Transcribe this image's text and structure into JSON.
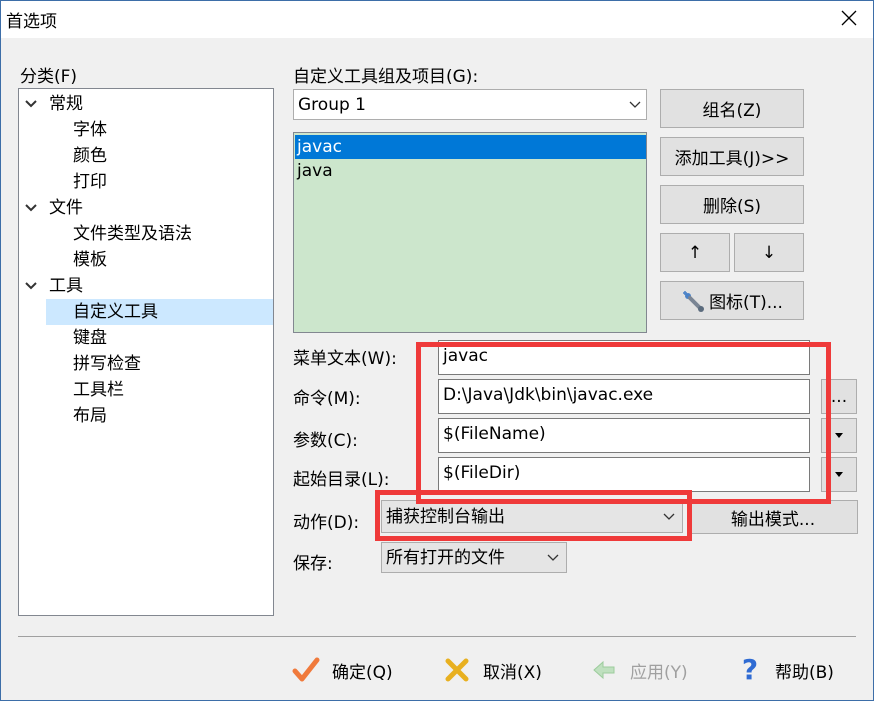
{
  "window": {
    "title": "首选项"
  },
  "left": {
    "label": "分类(F)",
    "tree": [
      {
        "label": "常规",
        "expanded": true,
        "level": 0
      },
      {
        "label": "字体",
        "level": 1
      },
      {
        "label": "颜色",
        "level": 1
      },
      {
        "label": "打印",
        "level": 1
      },
      {
        "label": "文件",
        "expanded": true,
        "level": 0
      },
      {
        "label": "文件类型及语法",
        "level": 1
      },
      {
        "label": "模板",
        "level": 1
      },
      {
        "label": "工具",
        "expanded": true,
        "level": 0
      },
      {
        "label": "自定义工具",
        "level": 1,
        "selected": true
      },
      {
        "label": "键盘",
        "level": 1
      },
      {
        "label": "拼写检查",
        "level": 1
      },
      {
        "label": "工具栏",
        "level": 1
      },
      {
        "label": "布局",
        "level": 1
      }
    ]
  },
  "group": {
    "label": "自定义工具组及项目(G):",
    "selected": "Group 1",
    "tools": [
      {
        "label": "javac",
        "selected": true
      },
      {
        "label": "java"
      }
    ]
  },
  "buttons": {
    "group_name": "组名(Z)",
    "add_tool": "添加工具(J)>>",
    "delete": "删除(S)",
    "up": "↑",
    "down": "↓",
    "icon": "图标(T)...",
    "output_mode": "输出模式...",
    "browse": "..."
  },
  "fields": {
    "menu_text": {
      "label": "菜单文本(W):",
      "value": "javac"
    },
    "command": {
      "label": "命令(M):",
      "value": "D:\\Java\\Jdk\\bin\\javac.exe"
    },
    "params": {
      "label": "参数(C):",
      "value": "$(FileName)"
    },
    "start_dir": {
      "label": "起始目录(L):",
      "value": "$(FileDir)"
    },
    "action": {
      "label": "动作(D):",
      "value": "捕获控制台输出"
    },
    "save": {
      "label": "保存:",
      "value": "所有打开的文件"
    }
  },
  "footer": {
    "ok": "确定(Q)",
    "cancel": "取消(X)",
    "apply": "应用(Y)",
    "help": "帮助(B)"
  },
  "colors": {
    "highlight": "#ef3a3a",
    "selection": "#0078d7",
    "list_bg": "#cce6cc",
    "tree_selection": "#cce8ff"
  }
}
